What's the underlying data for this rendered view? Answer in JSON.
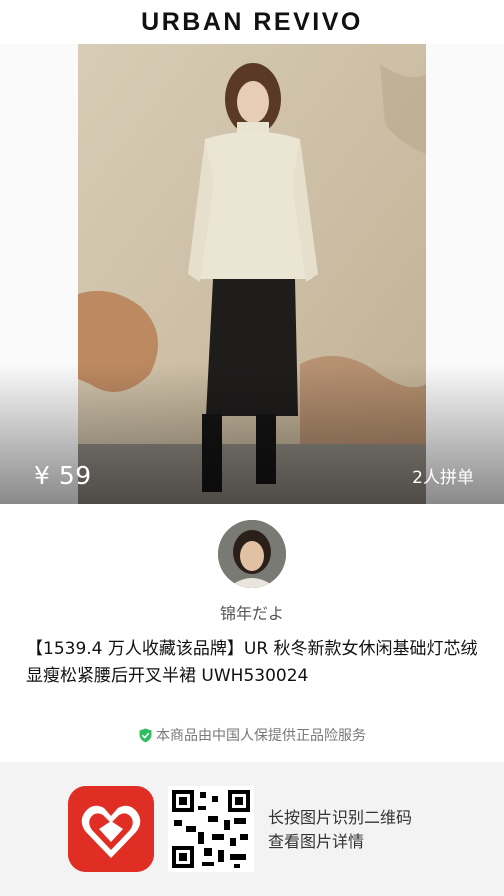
{
  "brand": {
    "name": "URBAN REVIVO"
  },
  "product": {
    "price": "¥ 59",
    "group_buy": "2人拼单",
    "title": "【1539.4 万人收藏该品牌】UR 秋冬新款女休闲基础灯芯绒显瘦松紧腰后开叉半裙 UWH530024",
    "guarantee": "本商品由中国人保提供正品险服务"
  },
  "seller": {
    "name": "锦年だよ"
  },
  "footer": {
    "hint_line1": "长按图片识别二维码",
    "hint_line2": "查看图片详情",
    "app_icon": "pinduoduo-logo-icon",
    "qr_icon": "qr-code-icon"
  },
  "colors": {
    "accent_red": "#e02e24",
    "guarantee_green": "#2dbf5f",
    "footer_bg": "#f3f3f3"
  }
}
